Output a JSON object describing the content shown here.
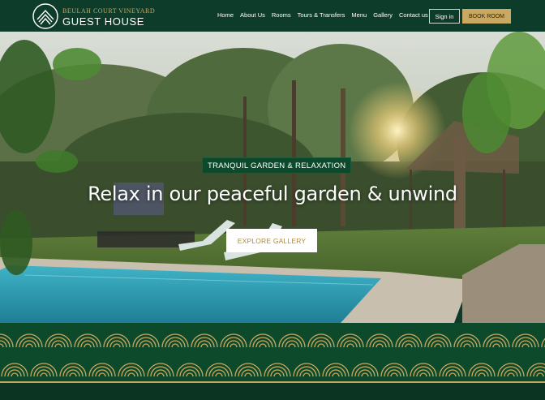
{
  "brand": {
    "line1": "BEULAH COURT VINEYARD",
    "line2": "GUEST HOUSE",
    "logo_icon": "mountain-circle-logo",
    "gold": "#c9a961",
    "green": "#0d3c2b"
  },
  "nav": {
    "items": [
      {
        "label": "Home"
      },
      {
        "label": "About Us"
      },
      {
        "label": "Rooms"
      },
      {
        "label": "Tours & Transfers"
      },
      {
        "label": "Menu"
      },
      {
        "label": "Gallery"
      },
      {
        "label": "Contact us"
      }
    ],
    "signin_label": "Sign in",
    "book_label": "BOOK ROOM"
  },
  "hero": {
    "tag": "TRANQUIL GARDEN & RELAXATION",
    "headline": "Relax in our peaceful garden & unwind",
    "cta_label": "EXPLORE GALLERY",
    "slides": 5,
    "active_slide": 3
  }
}
